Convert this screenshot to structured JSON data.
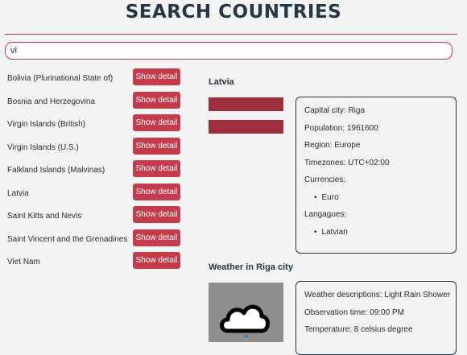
{
  "header": {
    "title": "SEARCH COUNTRIES"
  },
  "search": {
    "value": "vi"
  },
  "results": [
    {
      "name": "Bolivia (Plurinational State of)",
      "button": "Show detail"
    },
    {
      "name": "Bosnia and Herzegovina",
      "button": "Show detail"
    },
    {
      "name": "Virgin Islands (British)",
      "button": "Show detail"
    },
    {
      "name": "Virgin Islands (U.S.)",
      "button": "Show detail"
    },
    {
      "name": "Falkland Islands (Malvinas)",
      "button": "Show detail"
    },
    {
      "name": "Latvia",
      "button": "Show detail"
    },
    {
      "name": "Saint Kitts and Nevis",
      "button": "Show detail"
    },
    {
      "name": "Saint Vincent and the Grenadines",
      "button": "Show detail"
    },
    {
      "name": "Viet Nam",
      "button": "Show detail"
    }
  ],
  "detail": {
    "country_name": "Latvia",
    "capital": "Capital city: Riga",
    "population": "Population: 1961600",
    "region": "Region: Europe",
    "timezones": "Timezones: UTC+02:00",
    "currencies_label": "Currencies:",
    "currencies": [
      "Euro"
    ],
    "languages_label": "Langagues:",
    "languages": [
      "Latvian"
    ],
    "flag_color": "#9e2f3c"
  },
  "weather": {
    "title": "Weather in Riga city",
    "icon": "cloud-rain-icon",
    "descriptions": "Weather descriptions: Light Rain Shower",
    "observation": "Observation time: 09:00 PM",
    "temperature": "Temperature: 8 celsius degree"
  },
  "colors": {
    "accent": "#c43b4c",
    "heading": "#253746",
    "background": "#f3f3f3"
  }
}
